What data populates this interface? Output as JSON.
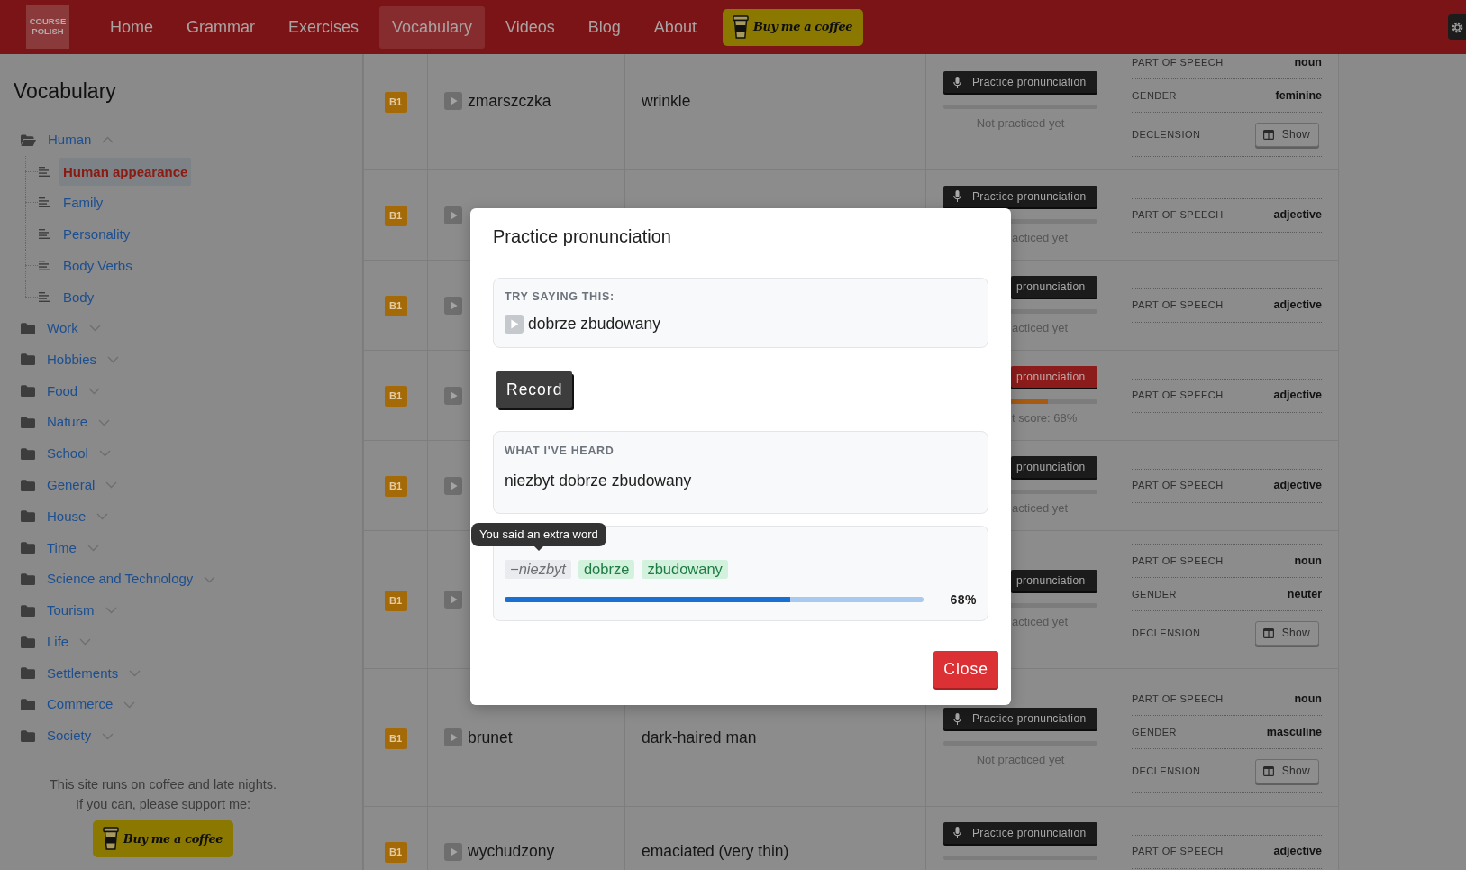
{
  "navbar": {
    "logo": [
      "COURSE",
      "POLISH"
    ],
    "links": [
      {
        "label": "Home",
        "selected": false
      },
      {
        "label": "Grammar",
        "selected": false
      },
      {
        "label": "Exercises",
        "selected": false
      },
      {
        "label": "Vocabulary",
        "selected": true
      },
      {
        "label": "Videos",
        "selected": false
      },
      {
        "label": "Blog",
        "selected": false
      },
      {
        "label": "About",
        "selected": false
      }
    ],
    "coffee_button": "Buy me a coffee"
  },
  "sidebar": {
    "title": "Vocabulary",
    "tree": [
      {
        "label": "Human",
        "expanded": true,
        "children": [
          {
            "label": "Human appearance",
            "selected": true
          },
          {
            "label": "Family",
            "selected": false
          },
          {
            "label": "Personality",
            "selected": false
          },
          {
            "label": "Body Verbs",
            "selected": false
          },
          {
            "label": "Body",
            "selected": false
          }
        ]
      },
      {
        "label": "Work",
        "expanded": false
      },
      {
        "label": "Hobbies",
        "expanded": false
      },
      {
        "label": "Food",
        "expanded": false
      },
      {
        "label": "Nature",
        "expanded": false
      },
      {
        "label": "School",
        "expanded": false
      },
      {
        "label": "General",
        "expanded": false
      },
      {
        "label": "House",
        "expanded": false
      },
      {
        "label": "Time",
        "expanded": false
      },
      {
        "label": "Science and Technology",
        "expanded": false
      },
      {
        "label": "Tourism",
        "expanded": false
      },
      {
        "label": "Life",
        "expanded": false
      },
      {
        "label": "Settlements",
        "expanded": false
      },
      {
        "label": "Commerce",
        "expanded": false
      },
      {
        "label": "Society",
        "expanded": false
      }
    ],
    "support_text": [
      "This site runs on coffee and late nights.",
      "If you can, please support me:"
    ],
    "coffee_button": "Buy me a coffee"
  },
  "table": {
    "rows": [
      {
        "badge": "B1",
        "word": "zmarszczka",
        "translation": "wrinkle",
        "practice": {
          "button": "Practice pronunciation",
          "active": false,
          "level": 0,
          "status": "Not practiced yet"
        },
        "details": [
          {
            "kind": "text",
            "label": "PART OF SPEECH",
            "value": "noun"
          },
          {
            "kind": "text",
            "label": "GENDER",
            "value": "feminine"
          },
          {
            "kind": "button",
            "label": "DECLENSION",
            "button": "Show"
          }
        ]
      },
      {
        "badge": "B1",
        "practice": {
          "button": "Practice pronunciation",
          "active": false,
          "level": 0,
          "status": "acticed yet"
        },
        "details": [
          {
            "kind": "text",
            "label": "PART OF SPEECH",
            "value": "adjective"
          }
        ]
      },
      {
        "badge": "B1",
        "practice": {
          "button": "pronunciation",
          "active": false,
          "level": 0,
          "status": "acticed yet"
        },
        "details": [
          {
            "kind": "text",
            "label": "PART OF SPEECH",
            "value": "adjective"
          }
        ]
      },
      {
        "badge": "B1",
        "practice": {
          "button": "pronunciation",
          "active": true,
          "level": 0.68,
          "status": "t score: 68%"
        },
        "details": [
          {
            "kind": "text",
            "label": "PART OF SPEECH",
            "value": "adjective"
          }
        ]
      },
      {
        "badge": "B1",
        "practice": {
          "button": "pronunciation",
          "active": false,
          "level": 0,
          "status": "acticed yet"
        },
        "details": [
          {
            "kind": "text",
            "label": "PART OF SPEECH",
            "value": "adjective"
          }
        ]
      },
      {
        "badge": "B1",
        "practice": {
          "button": "pronunciation",
          "active": false,
          "level": 0,
          "status": "acticed yet"
        },
        "details": [
          {
            "kind": "text",
            "label": "PART OF SPEECH",
            "value": "noun"
          },
          {
            "kind": "text",
            "label": "GENDER",
            "value": "neuter"
          },
          {
            "kind": "button",
            "label": "DECLENSION",
            "button": "Show"
          }
        ]
      },
      {
        "badge": "B1",
        "word": "brunet",
        "translation": "dark-haired man",
        "practice": {
          "button": "Practice pronunciation",
          "active": false,
          "level": 0,
          "status": "Not practiced yet"
        },
        "details": [
          {
            "kind": "text",
            "label": "PART OF SPEECH",
            "value": "noun"
          },
          {
            "kind": "text",
            "label": "GENDER",
            "value": "masculine"
          },
          {
            "kind": "button",
            "label": "DECLENSION",
            "button": "Show"
          }
        ]
      },
      {
        "badge": "B1",
        "word": "wychudzony",
        "translation": "emaciated (very thin)",
        "practice": {
          "button": "Practice pronunciation",
          "active": false,
          "level": 0
        },
        "details": [
          {
            "kind": "text",
            "label": "PART OF SPEECH",
            "value": "adjective"
          }
        ]
      }
    ]
  },
  "dialog": {
    "title": "Practice pronunciation",
    "prompt_label": "TRY SAYING THIS:",
    "prompt_phrase": "dobrze zbudowany",
    "record_button": "Record",
    "heard_label": "WHAT I'VE HEARD",
    "heard_text": "niezbyt dobrze zbudowany",
    "score": {
      "tokens": [
        {
          "kind": "extra",
          "text": "−niezbyt"
        },
        {
          "kind": "correct",
          "text": "dobrze"
        },
        {
          "kind": "correct",
          "text": "zbudowany"
        }
      ],
      "level": 0.68,
      "reading": "68%"
    },
    "tooltip": "You said an extra word",
    "close_button": "Close"
  }
}
